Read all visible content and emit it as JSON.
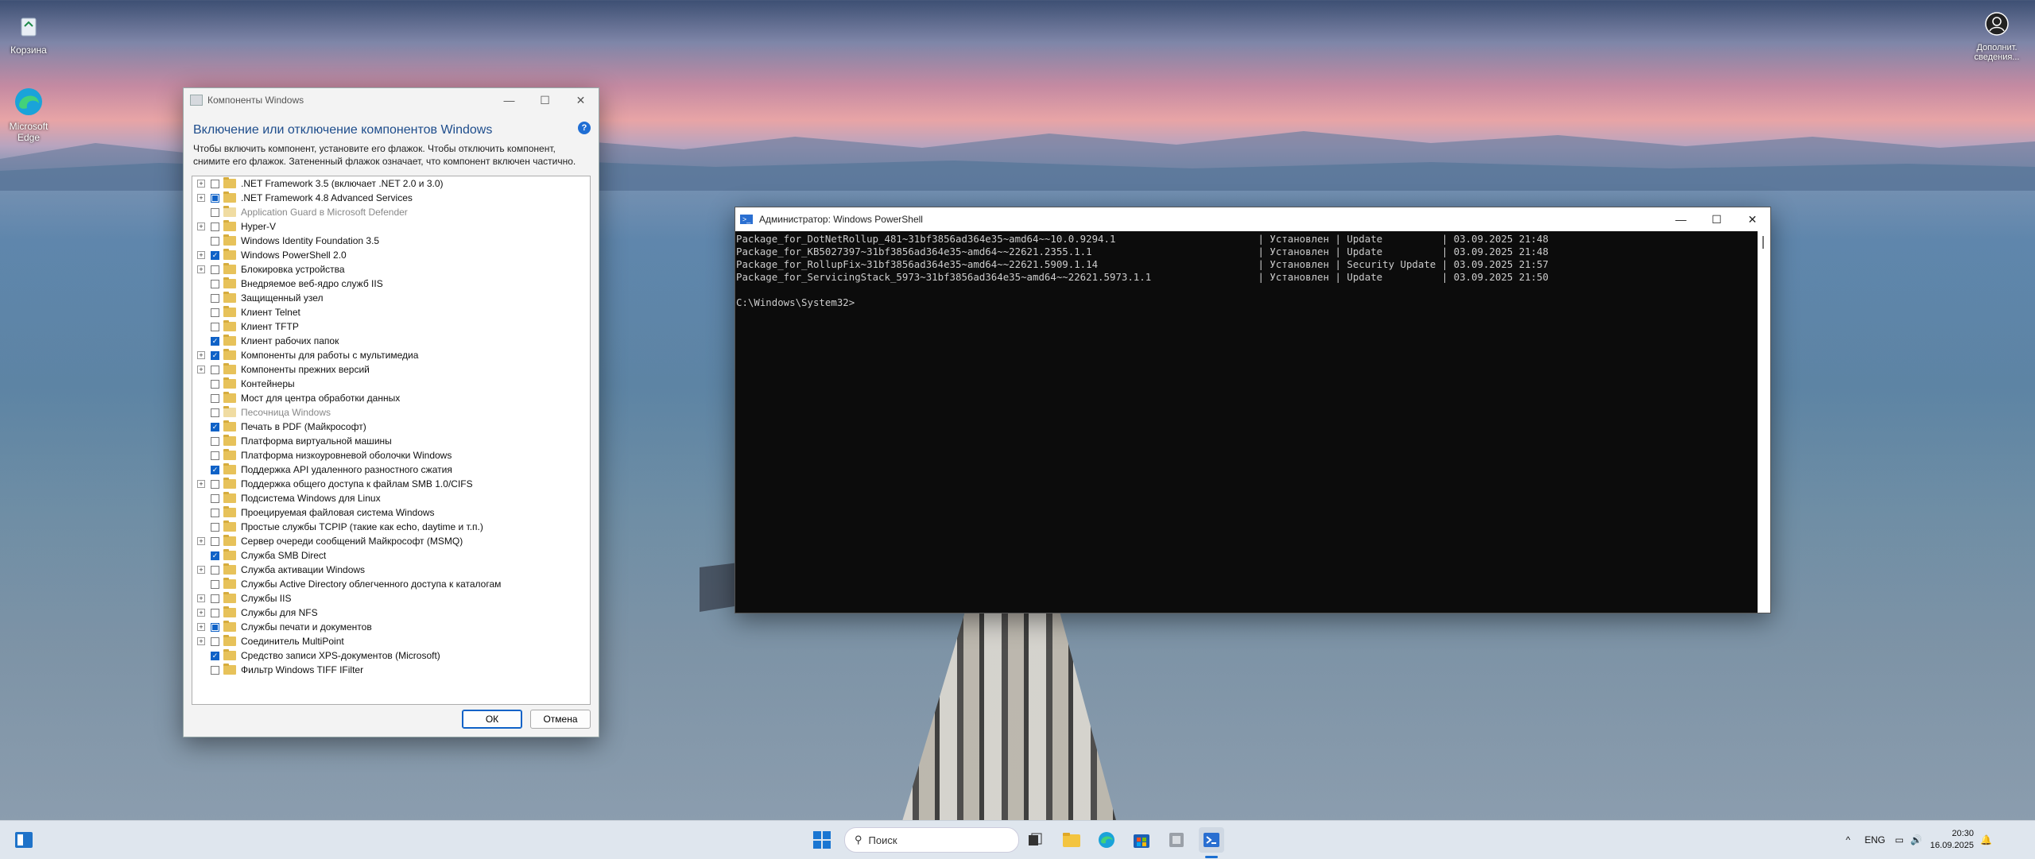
{
  "desktop": {
    "icons": [
      {
        "label": "Корзина",
        "icon": "recycle-bin-icon"
      },
      {
        "label": "Microsoft Edge",
        "icon": "edge-icon"
      },
      {
        "label": "Дополнит. сведения...",
        "icon": "user-circle-icon"
      }
    ]
  },
  "features_window": {
    "title": "Компоненты Windows",
    "heading": "Включение или отключение компонентов Windows",
    "description": "Чтобы включить компонент, установите его флажок. Чтобы отключить компонент, снимите его флажок. Затененный флажок означает, что компонент включен частично.",
    "ok_label": "ОК",
    "cancel_label": "Отмена",
    "items": [
      {
        "label": ".NET Framework 3.5 (включает .NET 2.0 и 3.0)",
        "expandable": true,
        "state": "unchecked",
        "disabled": false
      },
      {
        "label": ".NET Framework 4.8 Advanced Services",
        "expandable": true,
        "state": "partial",
        "disabled": false
      },
      {
        "label": "Application Guard в Microsoft Defender",
        "expandable": false,
        "state": "unchecked",
        "disabled": true
      },
      {
        "label": "Hyper-V",
        "expandable": true,
        "state": "unchecked",
        "disabled": false
      },
      {
        "label": "Windows Identity Foundation 3.5",
        "expandable": false,
        "state": "unchecked",
        "disabled": false
      },
      {
        "label": "Windows PowerShell 2.0",
        "expandable": true,
        "state": "checked",
        "disabled": false
      },
      {
        "label": "Блокировка устройства",
        "expandable": true,
        "state": "unchecked",
        "disabled": false
      },
      {
        "label": "Внедряемое веб-ядро служб IIS",
        "expandable": false,
        "state": "unchecked",
        "disabled": false
      },
      {
        "label": "Защищенный узел",
        "expandable": false,
        "state": "unchecked",
        "disabled": false
      },
      {
        "label": "Клиент Telnet",
        "expandable": false,
        "state": "unchecked",
        "disabled": false
      },
      {
        "label": "Клиент TFTP",
        "expandable": false,
        "state": "unchecked",
        "disabled": false
      },
      {
        "label": "Клиент рабочих папок",
        "expandable": false,
        "state": "checked",
        "disabled": false
      },
      {
        "label": "Компоненты для работы с мультимедиа",
        "expandable": true,
        "state": "checked",
        "disabled": false
      },
      {
        "label": "Компоненты прежних версий",
        "expandable": true,
        "state": "unchecked",
        "disabled": false
      },
      {
        "label": "Контейнеры",
        "expandable": false,
        "state": "unchecked",
        "disabled": false
      },
      {
        "label": "Мост для центра обработки данных",
        "expandable": false,
        "state": "unchecked",
        "disabled": false
      },
      {
        "label": "Песочница Windows",
        "expandable": false,
        "state": "unchecked",
        "disabled": true
      },
      {
        "label": "Печать в PDF (Майкрософт)",
        "expandable": false,
        "state": "checked",
        "disabled": false
      },
      {
        "label": "Платформа виртуальной машины",
        "expandable": false,
        "state": "unchecked",
        "disabled": false
      },
      {
        "label": "Платформа низкоуровневой оболочки Windows",
        "expandable": false,
        "state": "unchecked",
        "disabled": false
      },
      {
        "label": "Поддержка API удаленного разностного сжатия",
        "expandable": false,
        "state": "checked",
        "disabled": false
      },
      {
        "label": "Поддержка общего доступа к файлам SMB 1.0/CIFS",
        "expandable": true,
        "state": "unchecked",
        "disabled": false
      },
      {
        "label": "Подсистема Windows для Linux",
        "expandable": false,
        "state": "unchecked",
        "disabled": false
      },
      {
        "label": "Проецируемая файловая система Windows",
        "expandable": false,
        "state": "unchecked",
        "disabled": false
      },
      {
        "label": "Простые службы TCPIP (такие как echo, daytime и т.п.)",
        "expandable": false,
        "state": "unchecked",
        "disabled": false
      },
      {
        "label": "Сервер очереди сообщений Майкрософт (MSMQ)",
        "expandable": true,
        "state": "unchecked",
        "disabled": false
      },
      {
        "label": "Служба SMB Direct",
        "expandable": false,
        "state": "checked",
        "disabled": false
      },
      {
        "label": "Служба активации Windows",
        "expandable": true,
        "state": "unchecked",
        "disabled": false
      },
      {
        "label": "Службы Active Directory облегченного доступа к каталогам",
        "expandable": false,
        "state": "unchecked",
        "disabled": false
      },
      {
        "label": "Службы IIS",
        "expandable": true,
        "state": "unchecked",
        "disabled": false
      },
      {
        "label": "Службы для NFS",
        "expandable": true,
        "state": "unchecked",
        "disabled": false
      },
      {
        "label": "Службы печати и документов",
        "expandable": true,
        "state": "partial",
        "disabled": false
      },
      {
        "label": "Соединитель MultiPoint",
        "expandable": true,
        "state": "unchecked",
        "disabled": false
      },
      {
        "label": "Средство записи XPS-документов (Microsoft)",
        "expandable": false,
        "state": "checked",
        "disabled": false
      },
      {
        "label": "Фильтр Windows TIFF IFilter",
        "expandable": false,
        "state": "unchecked",
        "disabled": false
      }
    ]
  },
  "powershell": {
    "title": "Администратор: Windows PowerShell",
    "lines": [
      "Package_for_DotNetRollup_481~31bf3856ad364e35~amd64~~10.0.9294.1                        | Установлен | Update          | 03.09.2025 21:48",
      "Package_for_KB5027397~31bf3856ad364e35~amd64~~22621.2355.1.1                            | Установлен | Update          | 03.09.2025 21:48",
      "Package_for_RollupFix~31bf3856ad364e35~amd64~~22621.5909.1.14                           | Установлен | Security Update | 03.09.2025 21:57",
      "Package_for_ServicingStack_5973~31bf3856ad364e35~amd64~~22621.5973.1.1                  | Установлен | Update          | 03.09.2025 21:50",
      "",
      "C:\\Windows\\System32>"
    ]
  },
  "taskbar": {
    "search_placeholder": "Поиск",
    "language": "ENG",
    "time": "20:30",
    "date": "16.09.2025"
  }
}
